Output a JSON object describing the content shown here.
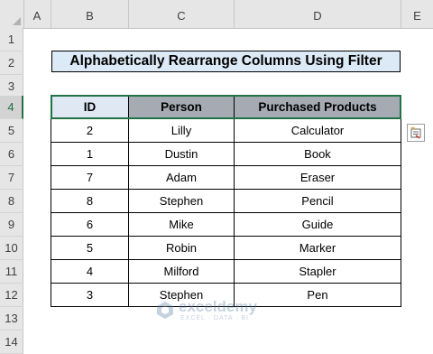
{
  "columns": [
    "A",
    "B",
    "C",
    "D",
    "E"
  ],
  "rows": [
    "1",
    "2",
    "3",
    "4",
    "5",
    "6",
    "7",
    "8",
    "9",
    "10",
    "11",
    "12",
    "13",
    "14"
  ],
  "title": "Alphabetically Rearrange Columns Using Filter",
  "table": {
    "headers": [
      "ID",
      "Person",
      "Purchased Products"
    ],
    "rows": [
      [
        "2",
        "Lilly",
        "Calculator"
      ],
      [
        "1",
        "Dustin",
        "Book"
      ],
      [
        "7",
        "Adam",
        "Eraser"
      ],
      [
        "8",
        "Stephen",
        "Pencil"
      ],
      [
        "6",
        "Mike",
        "Guide"
      ],
      [
        "5",
        "Robin",
        "Marker"
      ],
      [
        "4",
        "Milford",
        "Stapler"
      ],
      [
        "3",
        "Stephen",
        "Pen"
      ]
    ]
  },
  "watermark": {
    "name": "exceldemy",
    "tagline": "EXCEL · DATA · BI"
  },
  "icons": {
    "quick_analysis": "quick-analysis-icon",
    "logo": "exceldemy-logo-icon"
  },
  "colors": {
    "accent": "#217346",
    "title_fill": "#dce9f6",
    "header_fill": "#a6aab2"
  }
}
